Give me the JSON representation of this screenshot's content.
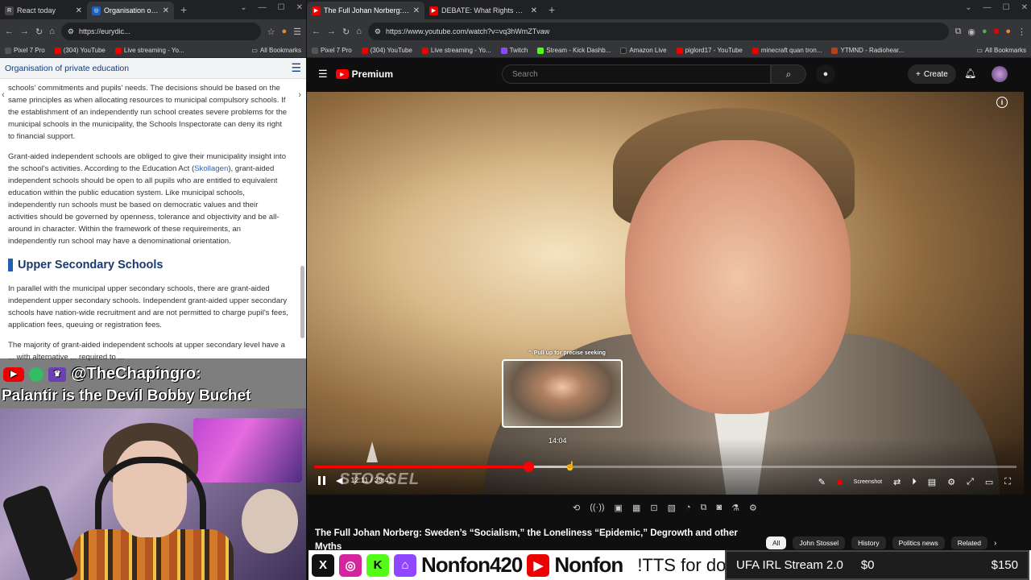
{
  "left_browser": {
    "tabs": [
      {
        "title": "React today",
        "active": false,
        "favicon_color": "#444"
      },
      {
        "title": "Organisation of pr",
        "active": true,
        "favicon_color": "#1f5fb4"
      }
    ],
    "url": "https://eurydic...",
    "bookmarks": [
      "Pixel 7 Pro",
      "(304) YouTube",
      "Live streaming - Yo..."
    ],
    "all_bookmarks": "All Bookmarks"
  },
  "page": {
    "header_title": "Organisation of private education",
    "para1": "schools' commitments and pupils' needs. The decisions should be based on the same principles as when allocating resources to municipal compulsory schools. If the establishment of an independently run school creates severe problems for the municipal schools in the municipality, the Schools Inspectorate can deny its right to financial support.",
    "para2_before": "Grant-aided independent schools are obliged to give their municipality insight into the school's activities. According to the Education Act (",
    "para2_link": "Skollagen",
    "para2_after": "), grant-aided independent schools should be open to all pupils who are entitled to equivalent education within the public education system. Like municipal schools, independently run schools must be based on democratic values and their activities should be governed by openness, tolerance and objectivity and be all-around in character. Within the framework of these requirements, an independently run school may have a denominational orientation.",
    "section_heading": "Upper Secondary Schools",
    "para3": "In parallel with the municipal upper secondary schools, there are grant-aided independent upper secondary schools. Independent grant-aided upper secondary schools have nation-wide recruitment and are not permitted to charge pupil's fees, application fees, queuing or registration fees.",
    "para4": "The majority of grant-aided independent schools at upper secondary level have a ... with alternative ... required to ... "
  },
  "chat_overlay": {
    "username": "@TheChapingro:",
    "message": "Palantir is the Devil Bobby Buchet"
  },
  "right_browser": {
    "tabs": [
      {
        "title": "The Full Johan Norberg: Sw",
        "active": true,
        "favicon_color": "#e00"
      },
      {
        "title": "DEBATE: What Rights Do We H",
        "active": false,
        "favicon_color": "#e00"
      }
    ],
    "url": "https://www.youtube.com/watch?v=vq3hWmZTvaw",
    "bookmarks": [
      "Pixel 7 Pro",
      "(304) YouTube",
      "Live streaming - Yo...",
      "Twitch",
      "Stream - Kick Dashb...",
      "Amazon Live",
      "piglord17 - YouTube",
      "minecraft quan tron...",
      "YTMND - Radiohear..."
    ],
    "bookmark_colors": [
      "#555",
      "#e00",
      "#e00",
      "#9146ff",
      "#53fc18",
      "#222",
      "#e00",
      "#e00",
      "#b5421f"
    ],
    "all_bookmarks": "All Bookmarks"
  },
  "youtube": {
    "logo_label": "Premium",
    "search_placeholder": "Search",
    "create_label": "Create",
    "preview_hint": "⌃ Pull up for precise seeking",
    "preview_time": "14:04",
    "current_time": "12:11 / 39:41",
    "progress_played": 0.305,
    "progress_buffered": 0.36,
    "watermark": "STOSSEL",
    "screenshot_label": "Screenshot",
    "video_title": "The Full Johan Norberg: Sweden’s “Socialism,” the Loneliness “Epidemic,” Degrowth and other Myths",
    "chips": [
      "All",
      "John Stossel",
      "History",
      "Politics news",
      "Related"
    ]
  },
  "stream_overlay": {
    "channel_name": "Nonfon420",
    "youtube_name": "Nonfon",
    "tts_text": "!TTS for dono link",
    "goal_label": "UFA IRL Stream 2.0",
    "goal_current": "$0",
    "goal_target": "$150",
    "colors": {
      "x": "#111",
      "instagram": "#d6249f",
      "kick": "#53fc18",
      "twitch": "#9146ff",
      "youtube": "#e00"
    }
  }
}
